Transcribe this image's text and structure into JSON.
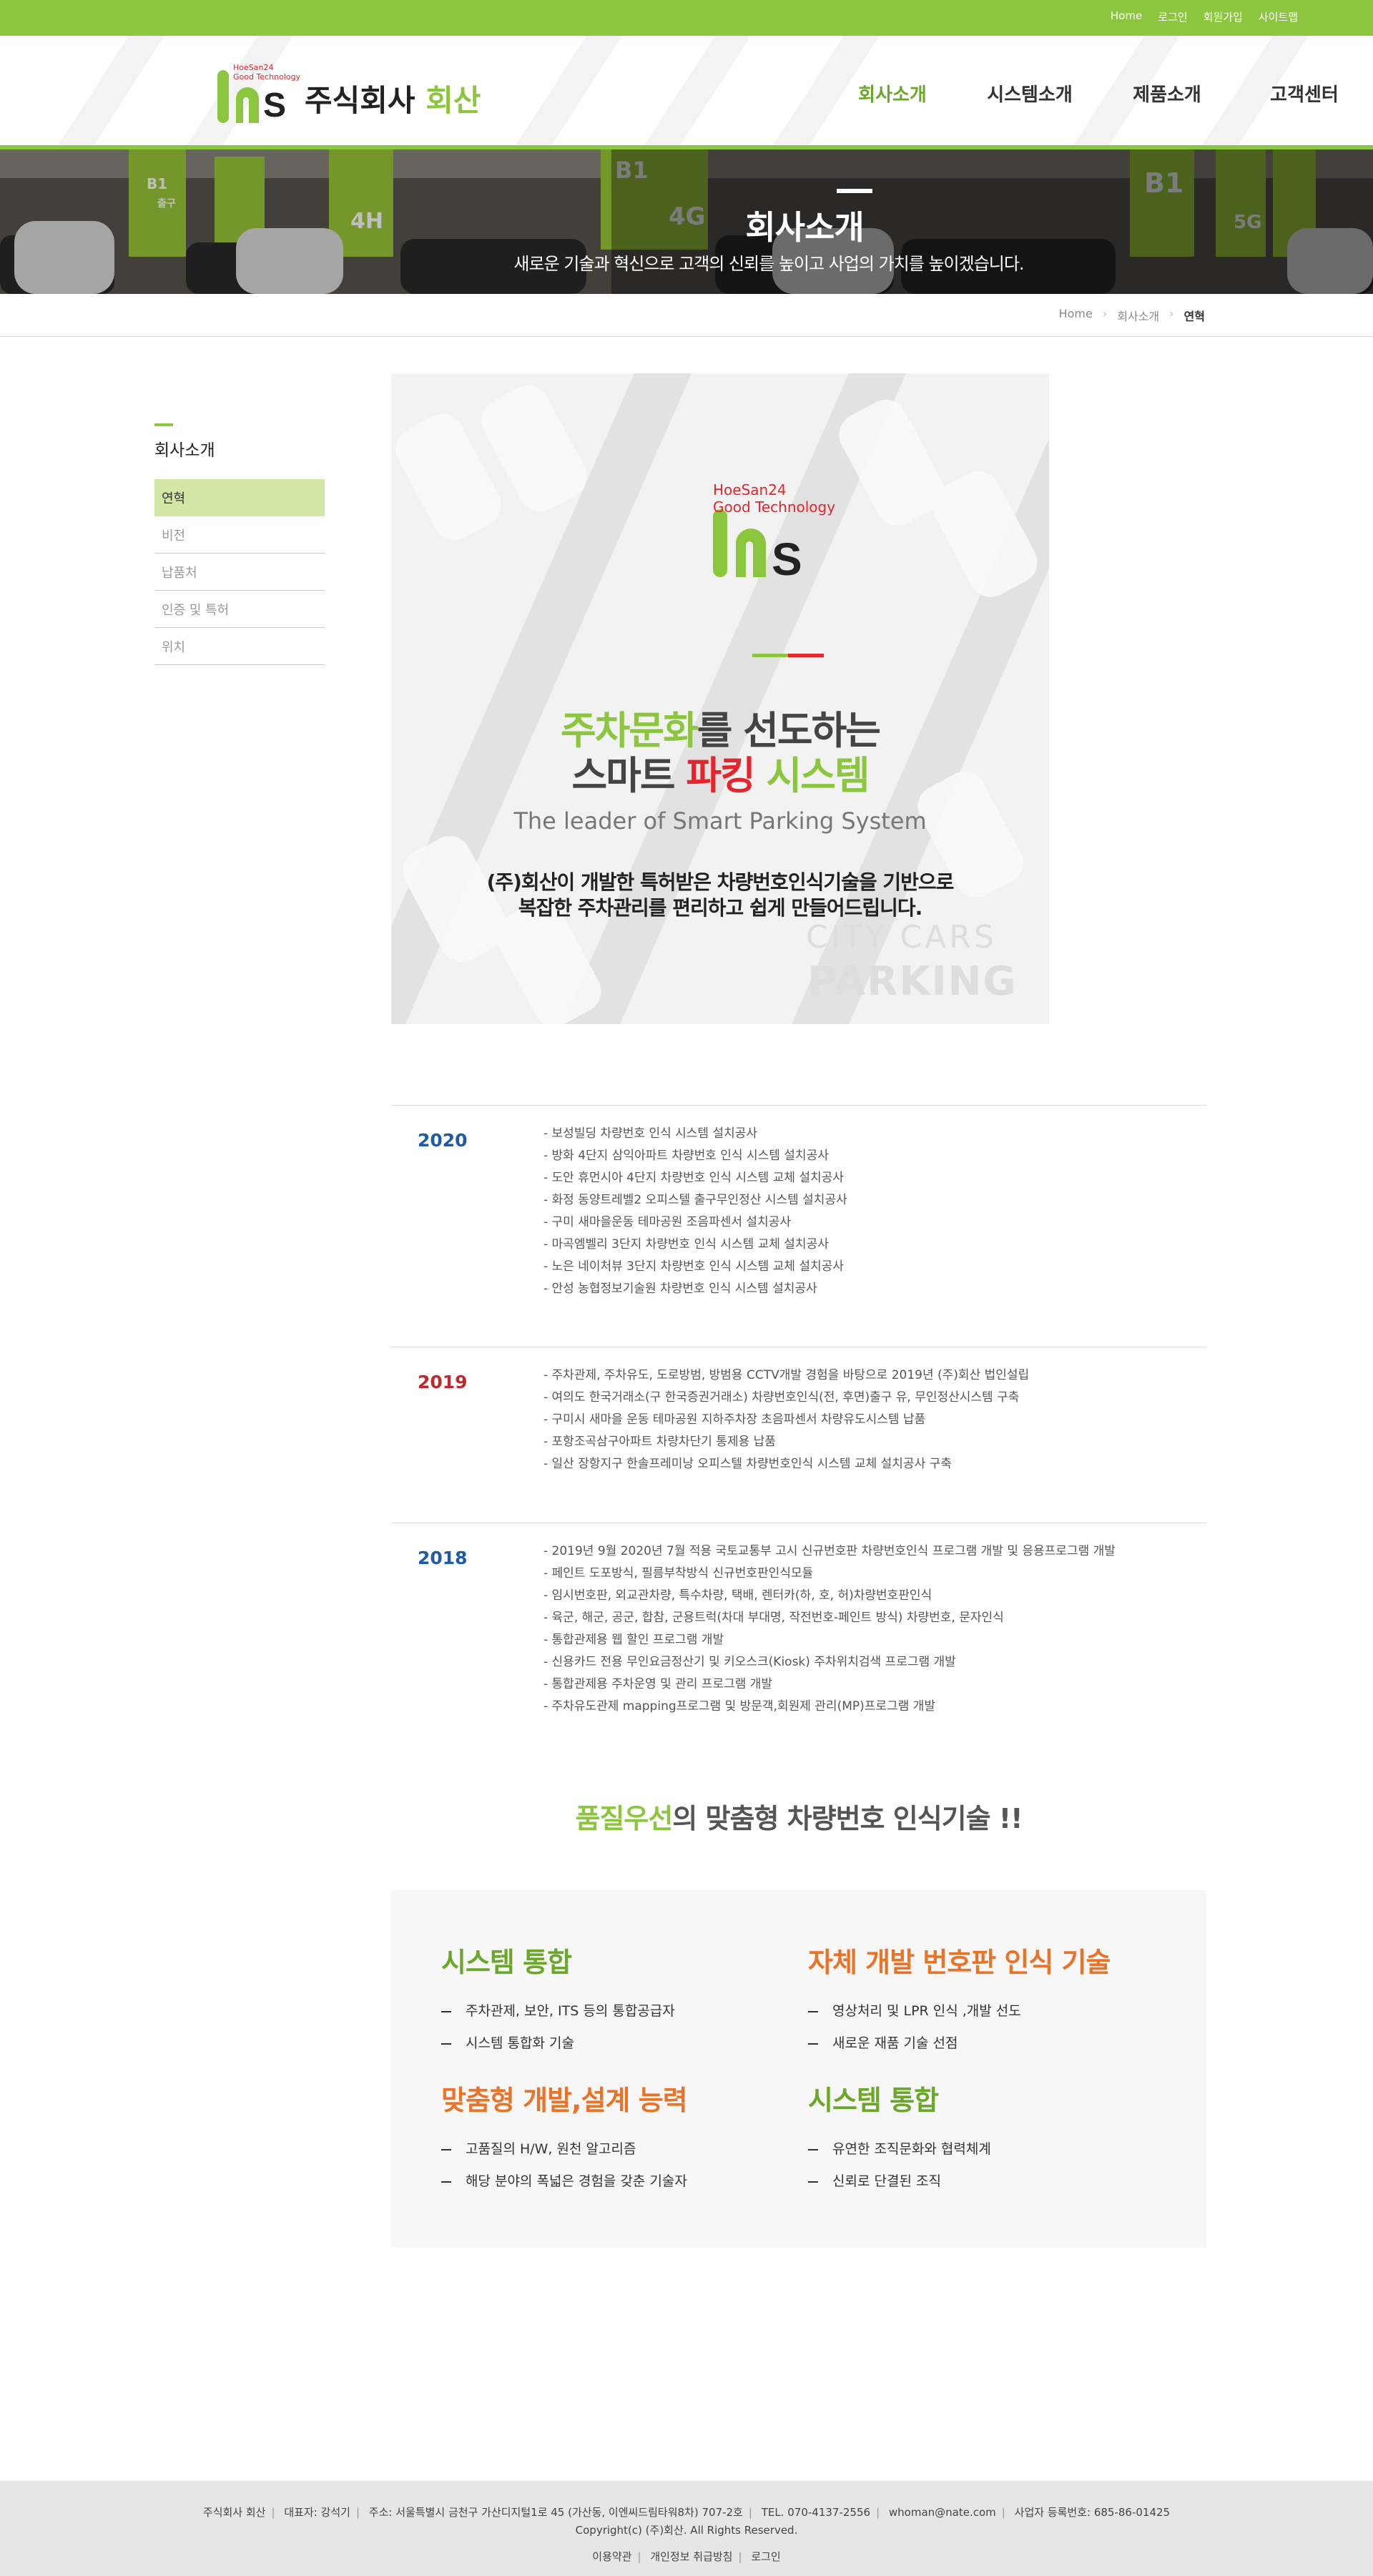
{
  "top_links": [
    "Home",
    "로그인",
    "회원가입",
    "사이트맵"
  ],
  "logo": {
    "line1": "HoeSan24",
    "line2": "Good Technology",
    "company_prefix": "주식회사",
    "company_name": "회산",
    "letters": "S"
  },
  "nav": [
    {
      "label": "회사소개",
      "active": true
    },
    {
      "label": "시스템소개",
      "active": false
    },
    {
      "label": "제품소개",
      "active": false
    },
    {
      "label": "고객센터",
      "active": false
    }
  ],
  "banner": {
    "title": "회사소개",
    "subtitle": "새로운 기술과 혁신으로 고객의 신뢰를 높이고 사업의 가치를 높이겠습니다.",
    "signs": [
      "B1",
      "4H",
      "4G",
      "B1",
      "5G",
      "B1",
      "출구"
    ]
  },
  "breadcrumb": [
    "Home",
    "회사소개",
    "연혁"
  ],
  "sidebar": {
    "title": "회사소개",
    "items": [
      {
        "label": "연혁",
        "active": true
      },
      {
        "label": "비전",
        "active": false
      },
      {
        "label": "납품처",
        "active": false
      },
      {
        "label": "인증 및 특허",
        "active": false
      },
      {
        "label": "위치",
        "active": false
      }
    ]
  },
  "hero": {
    "logo_line1": "HoeSan24",
    "logo_line2": "Good Technology",
    "logo_letter": "S",
    "line1_green": "주차문화",
    "line1_rest": "를 선도하는",
    "line2_start": "스마트 ",
    "line2_red": "파킹",
    "line2_green": " 시스템",
    "english": "The leader of Smart Parking System",
    "desc1_strong": "(주)회산",
    "desc1_rest": "이 개발한 특허받은 차량번호인식기술을 기반으로",
    "desc2": "복잡한 주차관리를 편리하고 쉽게 만들어드립니다.",
    "city": "CITY  CARS",
    "parking": "PARKING"
  },
  "history": [
    {
      "year": "2020",
      "color": "#1f5aa6",
      "items": [
        "- 보성빌딩 차량번호 인식 시스템 설치공사",
        "- 방화 4단지 삼익아파트 차량번호 인식 시스템 설치공사",
        "- 도안 휴먼시아 4단지 차량번호 인식 시스템 교체 설치공사",
        "- 화정 동양트레벨2 오피스텔 출구무인정산 시스템 설치공사",
        "- 구미 새마을운동 테마공원 조음파센서 설치공사",
        "- 마곡엠벨리 3단지 차량번호 인식 시스템 교체 설치공사",
        "- 노은 네이처뷰 3단지 차량번호 인식 시스템 교체 설치공사",
        "- 안성 농협정보기술원 차량번호 인식 시스템 설치공사"
      ]
    },
    {
      "year": "2019",
      "color": "#c0282d",
      "items": [
        "- 주차관제, 주차유도, 도로방범, 방범용 CCTV개발 경험을 바탕으로 2019년 (주)회산 법인설립",
        "- 여의도 한국거래소(구 한국증권거래소) 차량번호인식(전, 후면)출구 유, 무인정산시스템 구축",
        "- 구미시 새마을 운동 테마공원 지하주차장 초음파센서 차량유도시스템 납품",
        "- 포항조곡삼구아파트 차량차단기 통제용 납품",
        "- 일산 장항지구 한솔프레미낭 오피스텔 차량번호인식 시스템 교체 설치공사 구축"
      ]
    },
    {
      "year": "2018",
      "color": "#1f5aa6",
      "items": [
        "- 2019년 9월 2020년 7월 적용 국토교통부 고시 신규번호판 차량번호인식 프로그램 개발 및 응용프로그램 개발",
        "- 페인트 도포방식, 필름부착방식 신규번호판인식모듈",
        "- 임시번호판, 외교관차량, 특수차량, 택배, 렌터카(하, 호, 허)차량번호판인식",
        "- 육군, 해군, 공군, 합참, 군용트럭(차대 부대명, 작전번호-페인트 방식) 차량번호, 문자인식",
        "- 통합관제용 웹 할인 프로그램 개발",
        "- 신용카드 전용 무인요금정산기 및 키오스크(Kiosk) 주차위치검색 프로그램 개발",
        "- 통합관제용 주차운영 및 관리 프로그램 개발",
        "- 주차유도관제 mapping프로그램 및 방문객,회원제 관리(MP)프로그램 개발"
      ]
    }
  ],
  "quality": {
    "title_green": "품질우선",
    "title_rest": "의 맞춤형 차량번호 인식기술 !!",
    "blocks": [
      {
        "title": "시스템 통합",
        "color": "#6aa72a",
        "items": [
          "주차관제, 보안, ITS 등의 통합공급자",
          "시스템 통합화 기술"
        ]
      },
      {
        "title": "자체 개발 번호판 인식 기술",
        "color": "#e8742a",
        "items": [
          "영상처리 및 LPR 인식 ,개발 선도",
          "새로운 재품 기술 선점"
        ]
      },
      {
        "title": "맞춤형 개발,설계 능력",
        "color": "#e8742a",
        "items": [
          "고품질의 H/W, 원천 알고리즘",
          "해당 분야의 폭넓은 경험을 갖춘 기술자"
        ]
      },
      {
        "title": "시스템 통합",
        "color": "#6aa72a",
        "items": [
          "유연한 조직문화와 협력체계",
          "신뢰로 단결된 조직"
        ]
      }
    ]
  },
  "footer": {
    "info": [
      "주식회사 회산",
      "대표자: 강석기",
      "주소: 서울특별시 금천구 가산디지털1로 45 (가산동, 이엔씨드림타워8차) 707-2호",
      "TEL. 070-4137-2556",
      "whoman@nate.com",
      "사업자 등록번호: 685-86-01425"
    ],
    "copyright": "Copyright(c) (주)회산. All Rights Reserved.",
    "links": [
      "이용약관",
      "개인정보 취급방침",
      "로그인"
    ]
  }
}
